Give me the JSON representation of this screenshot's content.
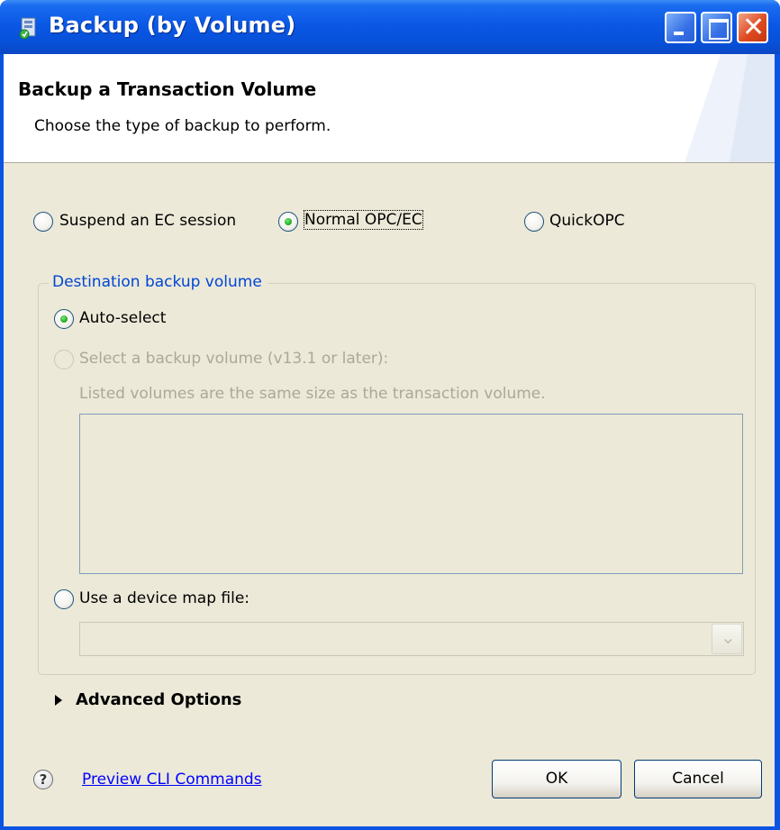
{
  "window": {
    "title": "Backup (by Volume)"
  },
  "banner": {
    "title": "Backup a Transaction Volume",
    "description": "Choose the type of backup to perform."
  },
  "backup_type": {
    "options": [
      {
        "label": "Suspend an EC session",
        "checked": false
      },
      {
        "label": "Normal OPC/EC",
        "checked": true
      },
      {
        "label": "QuickOPC",
        "checked": false
      }
    ]
  },
  "destination": {
    "legend": "Destination backup volume",
    "auto_select": "Auto-select",
    "select_volume": "Select a backup volume (v13.1 or later):",
    "hint": "Listed volumes are the same size as the transaction volume.",
    "device_map": "Use a device map file:"
  },
  "advanced": {
    "label": "Advanced Options"
  },
  "footer": {
    "help_glyph": "?",
    "preview_link": "Preview CLI Commands",
    "ok_label": "OK",
    "cancel_label": "Cancel"
  },
  "colors": {
    "titlebar": "#0b58e5",
    "dialog_bg": "#ece9d8",
    "legend": "#0046d5",
    "link": "#0000ff"
  }
}
